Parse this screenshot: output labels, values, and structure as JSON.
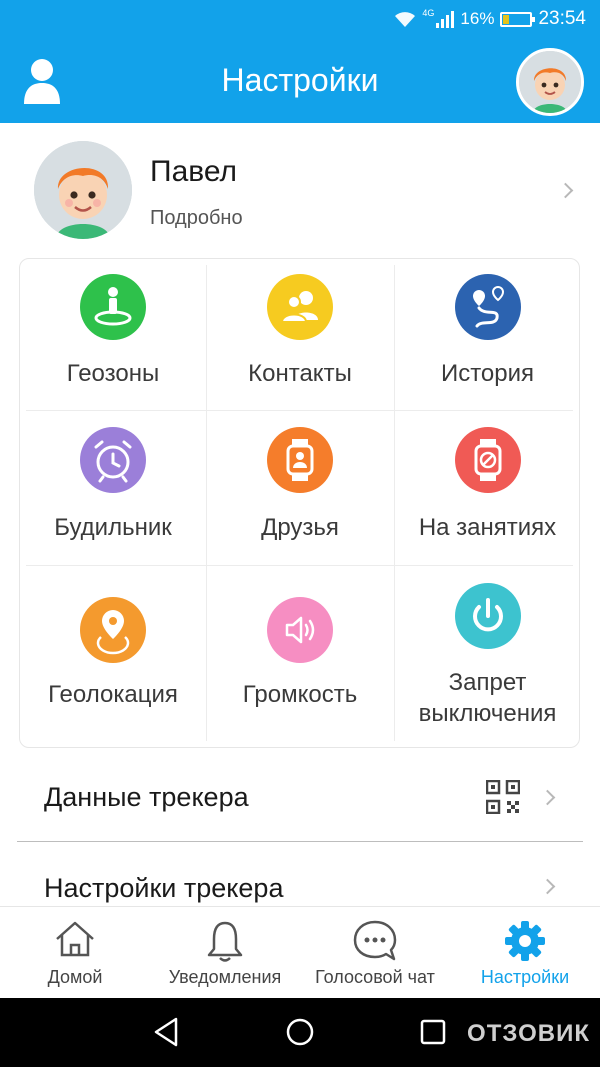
{
  "status": {
    "network": "4G",
    "battery": "16%",
    "time": "23:54",
    "battery_level": 0.16
  },
  "header": {
    "title": "Настройки"
  },
  "profile": {
    "name": "Павел",
    "detail": "Подробно"
  },
  "grid": [
    {
      "label": "Геозоны",
      "color": "#2ec14b",
      "icon": "geofence-icon"
    },
    {
      "label": "Контакты",
      "color": "#f6cb20",
      "icon": "contacts-icon"
    },
    {
      "label": "История",
      "color": "#2c63b0",
      "icon": "route-history-icon"
    },
    {
      "label": "Будильник",
      "color": "#9b7fd9",
      "icon": "alarm-clock-icon"
    },
    {
      "label": "Друзья",
      "color": "#f57d2b",
      "icon": "watch-friends-icon"
    },
    {
      "label": "На занятиях",
      "color": "#f05a55",
      "icon": "watch-blocked-icon"
    },
    {
      "label": "Геолокация",
      "color": "#f49a2e",
      "icon": "location-pin-icon"
    },
    {
      "label": "Громкость",
      "color": "#f68ec2",
      "icon": "volume-icon"
    },
    {
      "label_line1": "Запрет",
      "label_line2": "выключения",
      "color": "#3dc3cf",
      "icon": "power-icon"
    }
  ],
  "list": {
    "tracker_data": "Данные трекера",
    "tracker_settings": "Настройки трекера"
  },
  "nav": {
    "home": "Домой",
    "notifications": "Уведомления",
    "voice_chat": "Голосовой чат",
    "settings": "Настройки"
  },
  "watermark": "ОТЗОВИК",
  "colors": {
    "primary": "#12a2ea"
  }
}
